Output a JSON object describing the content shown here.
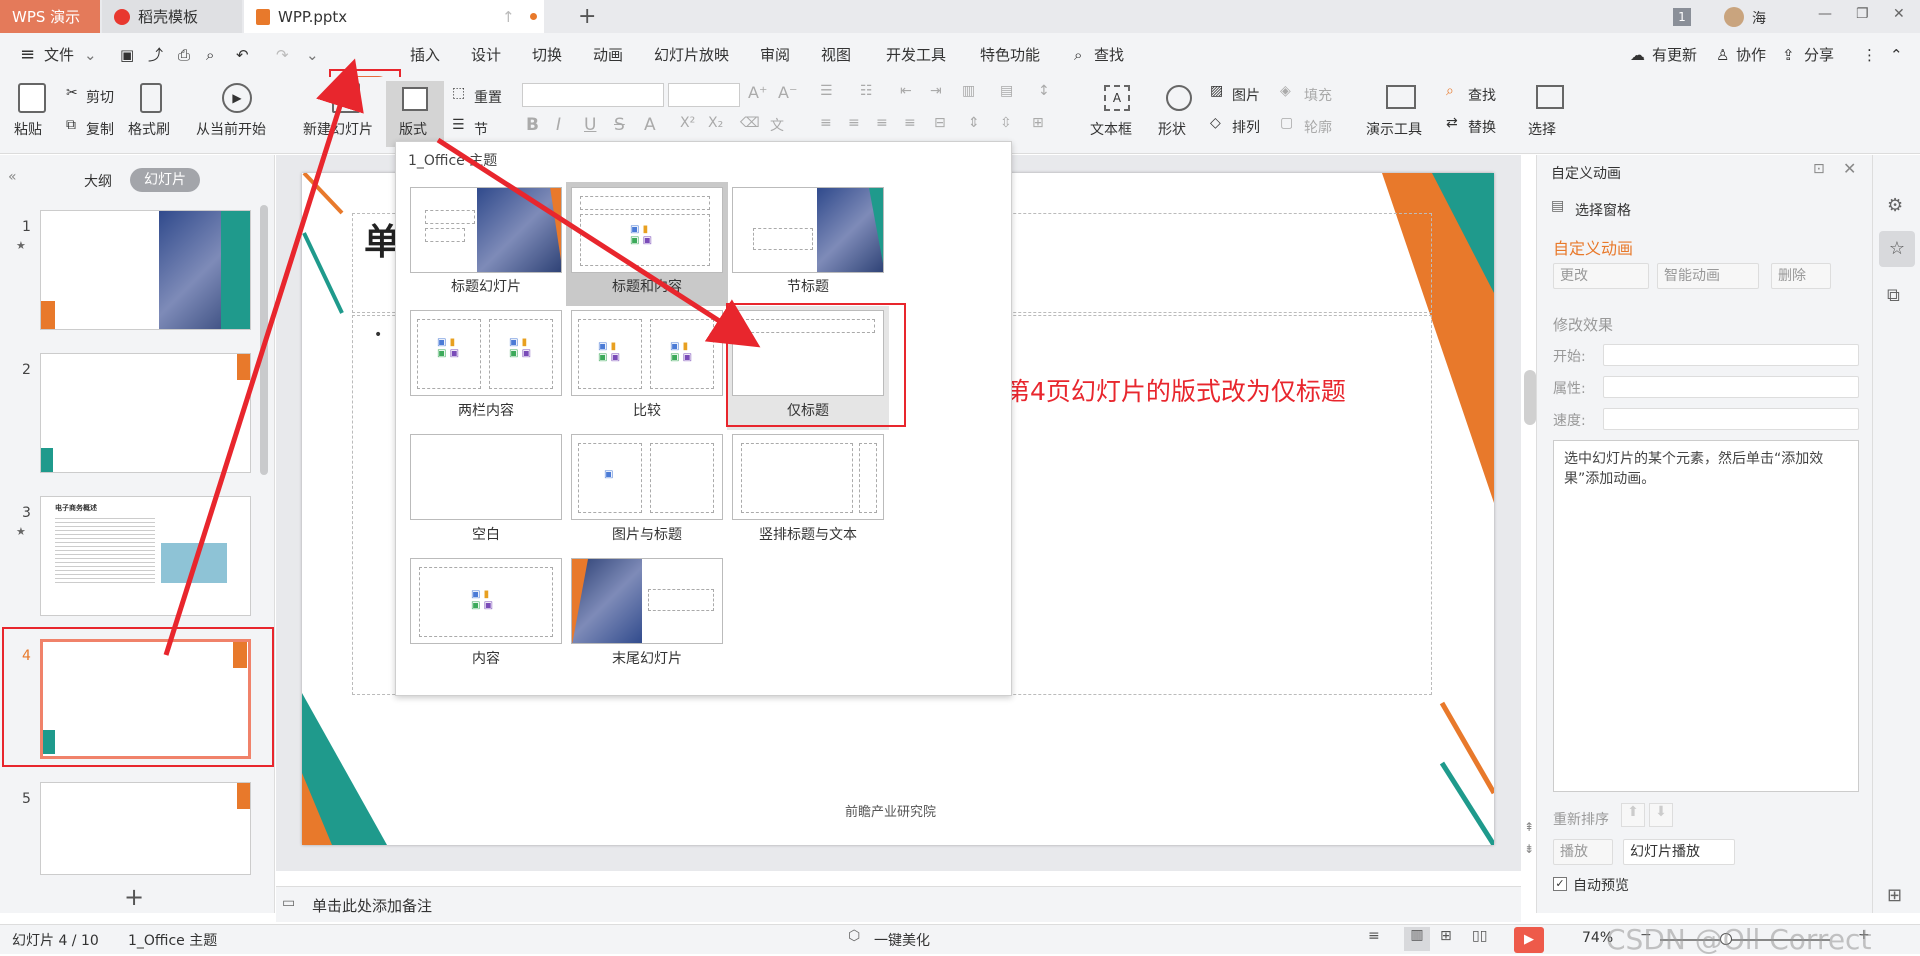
{
  "window": {
    "app_tab": "WPS 演示",
    "tabs": [
      {
        "label": "稻壳模板"
      },
      {
        "label": "WPP.pptx"
      }
    ],
    "new_tab": "+",
    "user_badge": "1",
    "user_name": "海",
    "controls": [
      "—",
      "❐",
      "✕"
    ]
  },
  "menu": {
    "file": "文件",
    "tabs": [
      "开始",
      "插入",
      "设计",
      "切换",
      "动画",
      "幻灯片放映",
      "审阅",
      "视图",
      "开发工具",
      "特色功能"
    ],
    "search": "查找",
    "right": [
      "有更新",
      "协作",
      "分享"
    ]
  },
  "ribbon": {
    "paste": "粘贴",
    "cut": "剪切",
    "copy": "复制",
    "format_painter": "格式刷",
    "from_current": "从当前开始",
    "new_slide": "新建幻灯片",
    "layout": "版式",
    "reset": "重置",
    "section": "节",
    "textbox": "文本框",
    "shape": "形状",
    "picture": "图片",
    "fill": "填充",
    "arrange": "排列",
    "outline": "轮廓",
    "present_tools": "演示工具",
    "find": "查找",
    "replace": "替换",
    "select": "选择"
  },
  "left_panel": {
    "outline_tab": "大纲",
    "slides_tab": "幻灯片",
    "slide_numbers": [
      "1",
      "2",
      "3",
      "4",
      "5"
    ],
    "slide3_title": "电子商务概述",
    "add": "+"
  },
  "layout_menu": {
    "header": "1_Office 主题",
    "items": [
      {
        "label": "标题幻灯片"
      },
      {
        "label": "标题和内容"
      },
      {
        "label": "节标题"
      },
      {
        "label": "两栏内容"
      },
      {
        "label": "比较"
      },
      {
        "label": "仅标题"
      },
      {
        "label": "空白"
      },
      {
        "label": "图片与标题"
      },
      {
        "label": "竖排标题与文本"
      },
      {
        "label": "内容"
      },
      {
        "label": "末尾幻灯片"
      }
    ]
  },
  "slide": {
    "title_char": "单",
    "footer": "前瞻产业研究院"
  },
  "annotation": {
    "text": "将第4页幻灯片的版式改为仅标题",
    "color": "#e8262d"
  },
  "right_panel": {
    "title": "自定义动画",
    "selection_pane": "选择窗格",
    "section_title": "自定义动画",
    "change": "更改",
    "smart_anim": "智能动画",
    "delete": "删除",
    "modify_effect": "修改效果",
    "start_label": "开始:",
    "property_label": "属性:",
    "speed_label": "速度:",
    "hint": "选中幻灯片的某个元素，然后单击“添加效果”添加动画。",
    "reorder": "重新排序",
    "play": "播放",
    "slideshow": "幻灯片播放",
    "auto_preview": "自动预览"
  },
  "notes": {
    "placeholder": "单击此处添加备注"
  },
  "status": {
    "slide_info": "幻灯片 4 / 10",
    "theme": "1_Office 主题",
    "beautify": "一键美化",
    "zoom": "74%",
    "watermark": "CSDN @Oll Correct"
  },
  "colors": {
    "accent": "#e8792b",
    "teal": "#1f9a8c",
    "wps_red": "#e45b41"
  }
}
